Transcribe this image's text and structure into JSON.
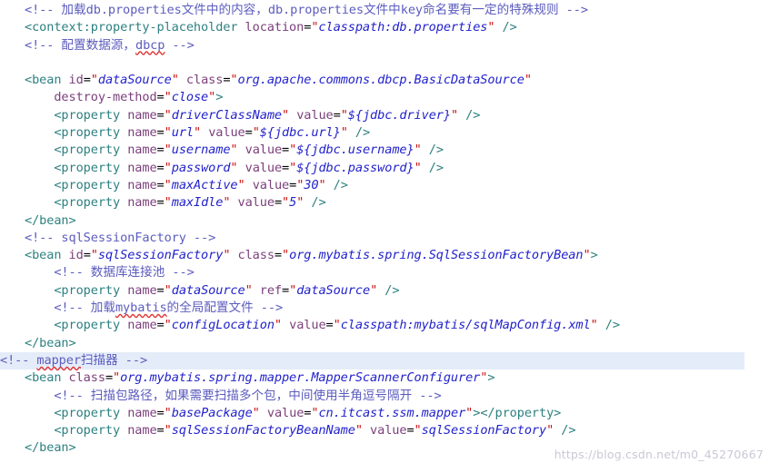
{
  "editor": {
    "language": "xml",
    "background_color": "#ffffff",
    "highlight_line_color": "#e4ecf9",
    "colors": {
      "tag": "#2e8080",
      "attribute_name": "#7b3f7b",
      "attribute_quote": "#cc1111",
      "attribute_value": "#2222cc",
      "comment": "#5c5cbf",
      "spellcheck_squiggle": "#e03030"
    },
    "highlighted_line_number": 22,
    "lines": [
      {
        "n": 1,
        "indent": 0,
        "text": "<!-- 加载db.properties文件中的内容，db.properties文件中key命名要有一定的特殊规则 -->"
      },
      {
        "n": 2,
        "indent": 0,
        "text": "<context:property-placeholder location=\"classpath:db.properties\" />"
      },
      {
        "n": 3,
        "indent": 0,
        "text": "<!-- 配置数据源，dbcp -->"
      },
      {
        "n": 4,
        "indent": 0,
        "text": ""
      },
      {
        "n": 5,
        "indent": 0,
        "text": "<bean id=\"dataSource\" class=\"org.apache.commons.dbcp.BasicDataSource\""
      },
      {
        "n": 6,
        "indent": 1,
        "text": "destroy-method=\"close\">"
      },
      {
        "n": 7,
        "indent": 1,
        "text": "<property name=\"driverClassName\" value=\"${jdbc.driver}\" />"
      },
      {
        "n": 8,
        "indent": 1,
        "text": "<property name=\"url\" value=\"${jdbc.url}\" />"
      },
      {
        "n": 9,
        "indent": 1,
        "text": "<property name=\"username\" value=\"${jdbc.username}\" />"
      },
      {
        "n": 10,
        "indent": 1,
        "text": "<property name=\"password\" value=\"${jdbc.password}\" />"
      },
      {
        "n": 11,
        "indent": 1,
        "text": "<property name=\"maxActive\" value=\"30\" />"
      },
      {
        "n": 12,
        "indent": 1,
        "text": "<property name=\"maxIdle\" value=\"5\" />"
      },
      {
        "n": 13,
        "indent": 0,
        "text": "</bean>"
      },
      {
        "n": 14,
        "indent": 0,
        "text": "<!-- sqlSessionFactory -->"
      },
      {
        "n": 15,
        "indent": 0,
        "text": "<bean id=\"sqlSessionFactory\" class=\"org.mybatis.spring.SqlSessionFactoryBean\">"
      },
      {
        "n": 16,
        "indent": 1,
        "text": "<!-- 数据库连接池 -->"
      },
      {
        "n": 17,
        "indent": 1,
        "text": "<property name=\"dataSource\" ref=\"dataSource\" />"
      },
      {
        "n": 18,
        "indent": 1,
        "text": "<!-- 加载mybatis的全局配置文件 -->"
      },
      {
        "n": 19,
        "indent": 1,
        "text": "<property name=\"configLocation\" value=\"classpath:mybatis/sqlMapConfig.xml\" />"
      },
      {
        "n": 20,
        "indent": 0,
        "text": "</bean>"
      },
      {
        "n": 21,
        "indent": 0,
        "text": "<!-- mapper扫描器 -->"
      },
      {
        "n": 22,
        "indent": 0,
        "text": "<bean class=\"org.mybatis.spring.mapper.MapperScannerConfigurer\">"
      },
      {
        "n": 23,
        "indent": 1,
        "text": "<!-- 扫描包路径，如果需要扫描多个包，中间使用半角逗号隔开 -->"
      },
      {
        "n": 24,
        "indent": 1,
        "text": "<property name=\"basePackage\" value=\"cn.itcast.ssm.mapper\"></property>"
      },
      {
        "n": 25,
        "indent": 1,
        "text": "<property name=\"sqlSessionFactoryBeanName\" value=\"sqlSessionFactory\" />"
      },
      {
        "n": 26,
        "indent": 0,
        "text": "</bean>"
      }
    ],
    "spellcheck_words": [
      "dbcp",
      "mybatis",
      "mapper"
    ]
  },
  "watermark": {
    "text": "https://blog.csdn.net/m0_45270667"
  }
}
